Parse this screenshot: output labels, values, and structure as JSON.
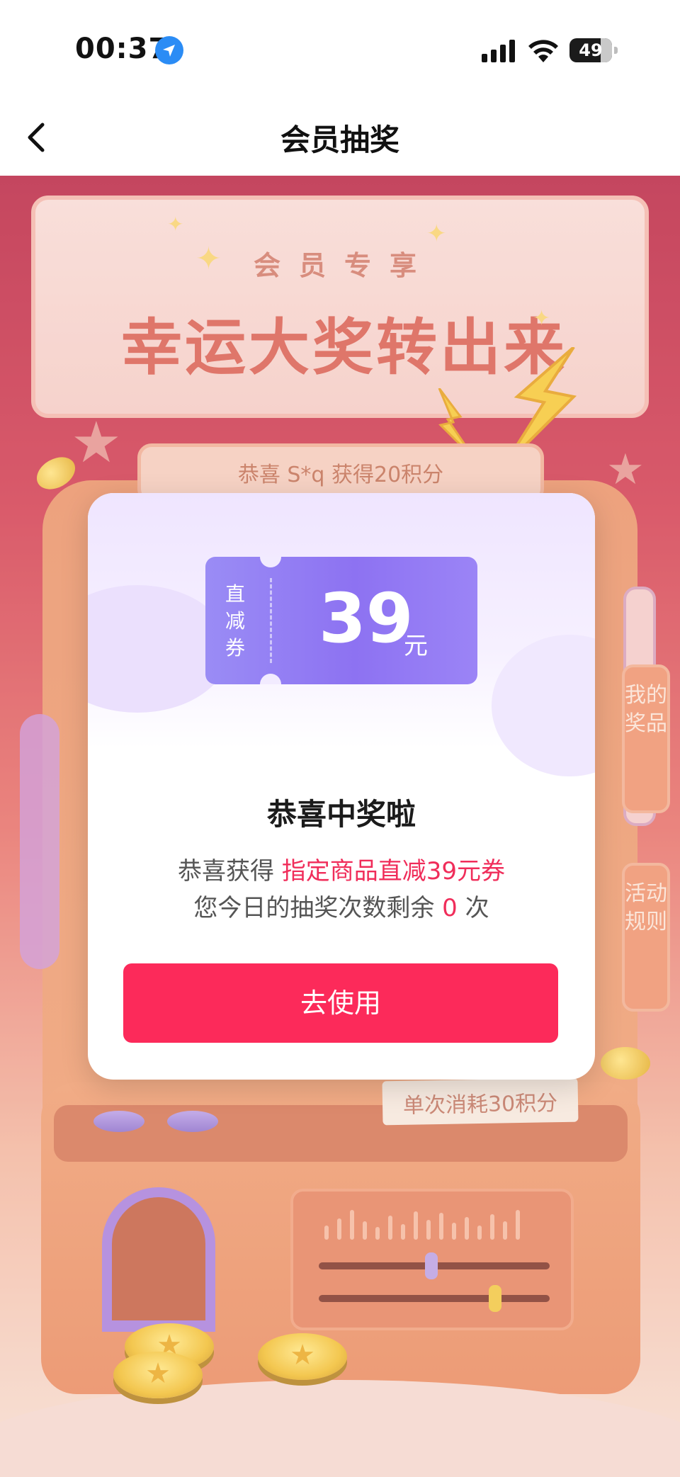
{
  "status_bar": {
    "time": "00:37",
    "battery_level": "49"
  },
  "nav": {
    "title": "会员抽奖"
  },
  "banner": {
    "subtitle": "会员专享",
    "title": "幸运大奖转出来"
  },
  "ticker": {
    "text": "恭喜 S*q 获得20积分"
  },
  "side_tabs": {
    "my_prizes": "我的奖品",
    "rules": "活动规则"
  },
  "machine": {
    "cost_label": "单次消耗30积分"
  },
  "modal": {
    "coupon": {
      "type_label": "直减券",
      "amount": "39",
      "unit": "元",
      "progress_lit_fraction": 0.0
    },
    "title": "恭喜中奖啦",
    "prize_prefix": "恭喜获得 ",
    "prize_name": "指定商品直减39元券",
    "remaining_prefix": "您今日的抽奖次数剩余 ",
    "remaining_count": "0",
    "remaining_suffix": " 次",
    "button_label": "去使用"
  },
  "colors": {
    "accent_red": "#fc2a5a",
    "highlight_text": "#f02d5a",
    "coupon_purple": "#8d72f2",
    "location_blue": "#2b8cf5"
  },
  "icons": {
    "back": "chevron-left-icon",
    "location": "location-arrow-icon",
    "signal": "cellular-signal-icon",
    "wifi": "wifi-icon",
    "battery": "battery-icon"
  }
}
